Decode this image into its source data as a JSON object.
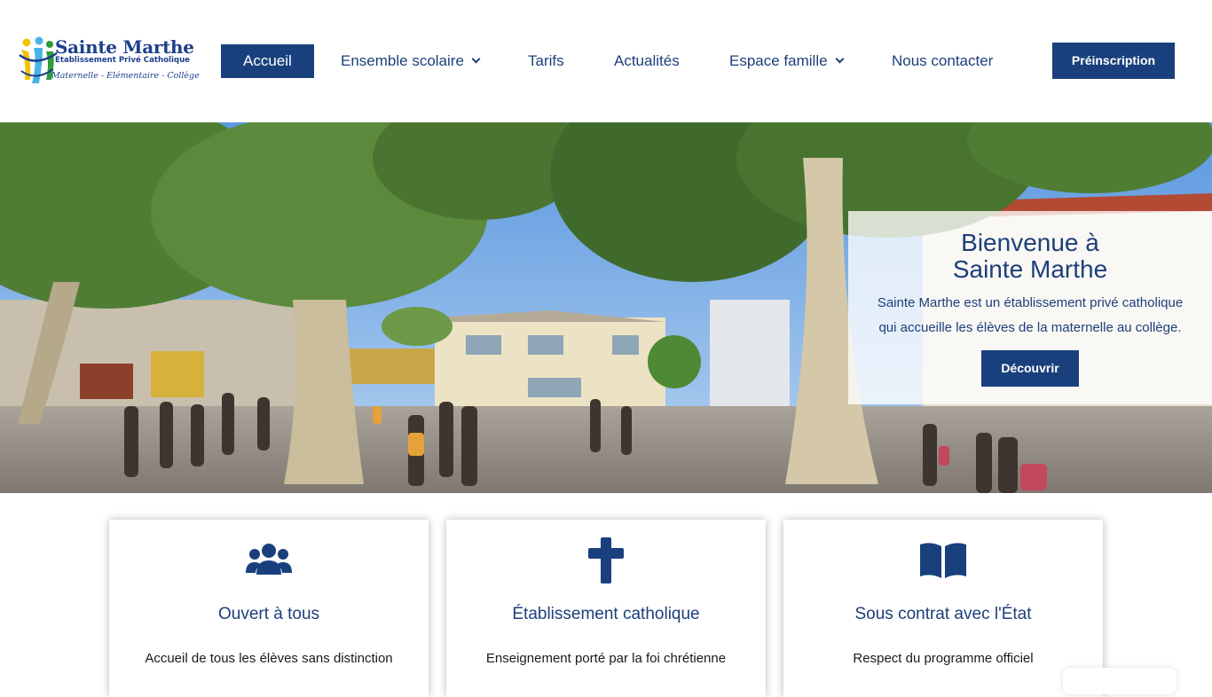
{
  "brand": {
    "name": "Sainte Marthe",
    "subtitle": "Etablissement Privé Catholique",
    "tagline": "Maternelle - Elémentaire - Collège"
  },
  "nav": {
    "items": [
      {
        "label": "Accueil",
        "active": true,
        "dropdown": false
      },
      {
        "label": "Ensemble scolaire",
        "active": false,
        "dropdown": true
      },
      {
        "label": "Tarifs",
        "active": false,
        "dropdown": false
      },
      {
        "label": "Actualités",
        "active": false,
        "dropdown": false
      },
      {
        "label": "Espace famille",
        "active": false,
        "dropdown": true
      },
      {
        "label": "Nous contacter",
        "active": false,
        "dropdown": false
      }
    ],
    "cta_label": "Préinscription"
  },
  "hero": {
    "title_line1": "Bienvenue à",
    "title_line2": "Sainte Marthe",
    "text_line1": "Sainte Marthe est un établissement privé catholique",
    "text_line2": "qui accueille les élèves de la maternelle au collège.",
    "button_label": "Découvrir"
  },
  "features": [
    {
      "icon": "users-icon",
      "title": "Ouvert à tous",
      "text": "Accueil de tous les élèves sans distinction"
    },
    {
      "icon": "cross-icon",
      "title": "Établissement catholique",
      "text": "Enseignement porté par la foi chrétienne"
    },
    {
      "icon": "book-open-icon",
      "title": "Sous contrat avec l'État",
      "text": "Respect du programme officiel"
    }
  ],
  "colors": {
    "primary": "#19407d",
    "text_dark": "#1a1a1a"
  }
}
